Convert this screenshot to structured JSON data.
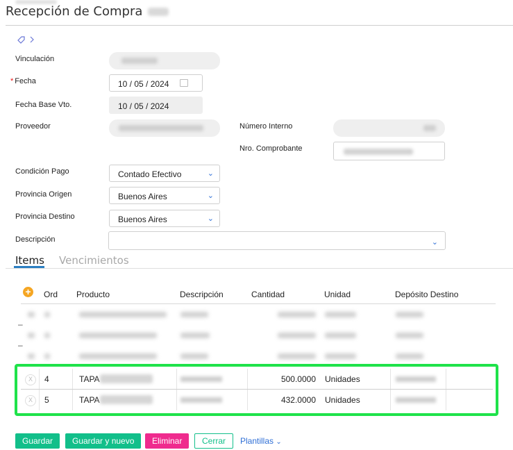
{
  "header": {
    "title": "Recepción de Compra"
  },
  "form": {
    "vinculacion_label": "Vinculación",
    "fecha_label": "Fecha",
    "fecha_required": "*",
    "fecha_value": "10 / 05 / 2024",
    "fecha_base_label": "Fecha Base Vto.",
    "fecha_base_value": "10 / 05 / 2024",
    "proveedor_label": "Proveedor",
    "numero_interno_label": "Número Interno",
    "nro_comprobante_label": "Nro. Comprobante",
    "condicion_pago_label": "Condición Pago",
    "condicion_pago_value": "Contado Efectivo",
    "provincia_origen_label": "Provincia Origen",
    "provincia_origen_value": "Buenos Aires",
    "provincia_destino_label": "Provincia Destino",
    "provincia_destino_value": "Buenos Aires",
    "descripcion_label": "Descripción"
  },
  "tabs": [
    {
      "label": "Items",
      "active": true
    },
    {
      "label": "Vencimientos",
      "active": false
    }
  ],
  "table": {
    "add_symbol": "+",
    "headers": [
      "Ord",
      "Producto",
      "Descripción",
      "Cantidad",
      "Unidad",
      "Depósito Destino"
    ],
    "rows": [
      {
        "ord": "4",
        "producto": "TAPA",
        "cantidad": "500.0000",
        "unidad": "Unidades"
      },
      {
        "ord": "5",
        "producto": "TAPA",
        "cantidad": "432.0000",
        "unidad": "Unidades"
      }
    ],
    "remove_symbol": "X"
  },
  "buttons": {
    "guardar": "Guardar",
    "guardar_nuevo": "Guardar y nuevo",
    "eliminar": "Eliminar",
    "cerrar": "Cerrar",
    "plantillas": "Plantillas"
  },
  "colors": {
    "primary": "#12bf8a",
    "danger": "#ef2b8e",
    "link": "#2f6fd6",
    "highlight": "#1fe24a",
    "tab_active": "#2b7fc2"
  }
}
